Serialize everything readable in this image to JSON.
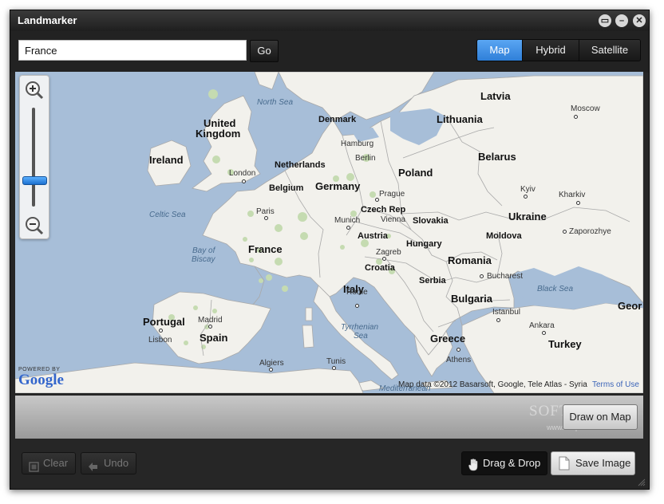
{
  "window": {
    "title": "Landmarker"
  },
  "titlebar_buttons": [
    {
      "name": "feedback-icon",
      "glyph": "▭"
    },
    {
      "name": "minimize-icon",
      "glyph": "–"
    },
    {
      "name": "close-icon",
      "glyph": "✕"
    }
  ],
  "search": {
    "value": "France",
    "go_label": "Go"
  },
  "view_modes": {
    "active": "Map",
    "items": [
      "Map",
      "Hybrid",
      "Satellite"
    ]
  },
  "map": {
    "countries": [
      "United Kingdom",
      "Ireland",
      "Denmark",
      "Netherlands",
      "Belgium",
      "Germany",
      "France",
      "Poland",
      "Latvia",
      "Lithuania",
      "Belarus",
      "Czech Rep",
      "Slovakia",
      "Austria",
      "Hungary",
      "Ukraine",
      "Moldova",
      "Romania",
      "Croatia",
      "Serbia",
      "Bulgaria",
      "Italy",
      "Portugal",
      "Spain",
      "Greece",
      "Turkey",
      "Geor"
    ],
    "cities": [
      "London",
      "Paris",
      "Hamburg",
      "Berlin",
      "Prague",
      "Munich",
      "Vienna",
      "Zagreb",
      "Rome",
      "Madrid",
      "Lisbon",
      "Algiers",
      "Tunis",
      "Athens",
      "Istanbul",
      "Ankara",
      "Bucharest",
      "Kyiv",
      "Kharkiv",
      "Zaporozhye",
      "Moscow"
    ],
    "seas": [
      "North Sea",
      "Celtic Sea",
      "Bay of Biscay",
      "Tyrrhenian Sea",
      "Black Sea",
      "Mediterranean"
    ],
    "attribution": "Map data ©2012  Basarsoft, Google, Tele Atlas - Syria",
    "terms_link": "Terms of Use",
    "powered_by": "POWERED BY",
    "google": "Google",
    "zoom_in_icon": "zoom-in-icon",
    "zoom_out_icon": "zoom-out-icon",
    "zoom_level_fraction": 0.28
  },
  "panel": {
    "draw_label": "Draw on Map",
    "watermark": "SOFTPEDIA",
    "watermark_url": "www.softpedia.com"
  },
  "bottom": {
    "clear_label": "Clear",
    "undo_label": "Undo",
    "drag_label": "Drag & Drop",
    "save_label": "Save Image"
  },
  "colors": {
    "accent": "#3d8ee6",
    "water": "#a7bed8",
    "land": "#f2f1ec",
    "park": "#c5dbb1",
    "border": "#a9a9a9"
  }
}
